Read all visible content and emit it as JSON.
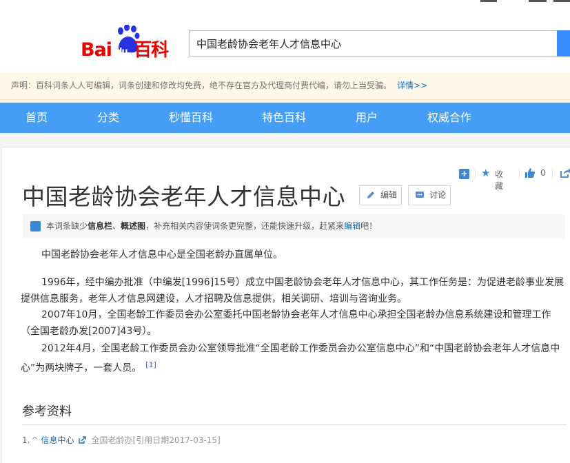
{
  "header": {
    "logo_bai": "Bai",
    "logo_du": "du",
    "logo_baike": "百科",
    "search_value": "中国老龄协会老年人才信息中心"
  },
  "notice": {
    "text": "声明：百科词条人人可编辑，词条创建和修改均免费，绝不存在官方及代理商付费代编，请勿上当受骗。",
    "more": "详情>>"
  },
  "nav": {
    "items": [
      "首页",
      "分类",
      "秒懂百科",
      "特色百科",
      "用户",
      "权威合作"
    ]
  },
  "tools": {
    "collect": "收藏",
    "like_count": "0"
  },
  "article": {
    "title": "中国老龄协会老年人才信息中心",
    "edit": "编辑",
    "discuss": "讨论",
    "tip_pre": "本词条缺少",
    "tip_b1": "信息栏",
    "tip_sep": "、",
    "tip_b2": "概述图",
    "tip_mid": "，补充相关内容使词条更完整，还能快速升级，赶紧来",
    "tip_link": "编辑",
    "tip_end": "吧！",
    "paragraphs": [
      "中国老龄协会老年人才信息中心是全国老龄办直属单位。",
      "1996年，经中编办批准（中编发[1996]15号）成立中国老龄协会老年人才信息中心，其工作任务是：为促进老龄事业发展提供信息服务，老年人才信息网建设，人才招聘及信息提供，相关调研、培训与咨询业务。",
      "2007年10月，全国老龄工作委员会办公室委托中国老龄协会老年人才信息中心承担全国老龄办信息系统建设和管理工作（全国老龄办发[2007]43号）。",
      "2012年4月，全国老龄工作委员会办公室领导批准“全国老龄工作委员会办公室信息中心”和“中国老龄协会老年人才信息中心”为两块牌子，一套人员。"
    ],
    "cite": "[1]",
    "ref_title": "参考资料",
    "ref": {
      "num": "1.",
      "up": "^",
      "link": "信息中心",
      "source": "全国老龄办[引用日期2017-03-15]"
    }
  },
  "colors": {
    "nav_bg": "#459df5",
    "brand_red": "#e10602",
    "link": "#136ec2"
  }
}
